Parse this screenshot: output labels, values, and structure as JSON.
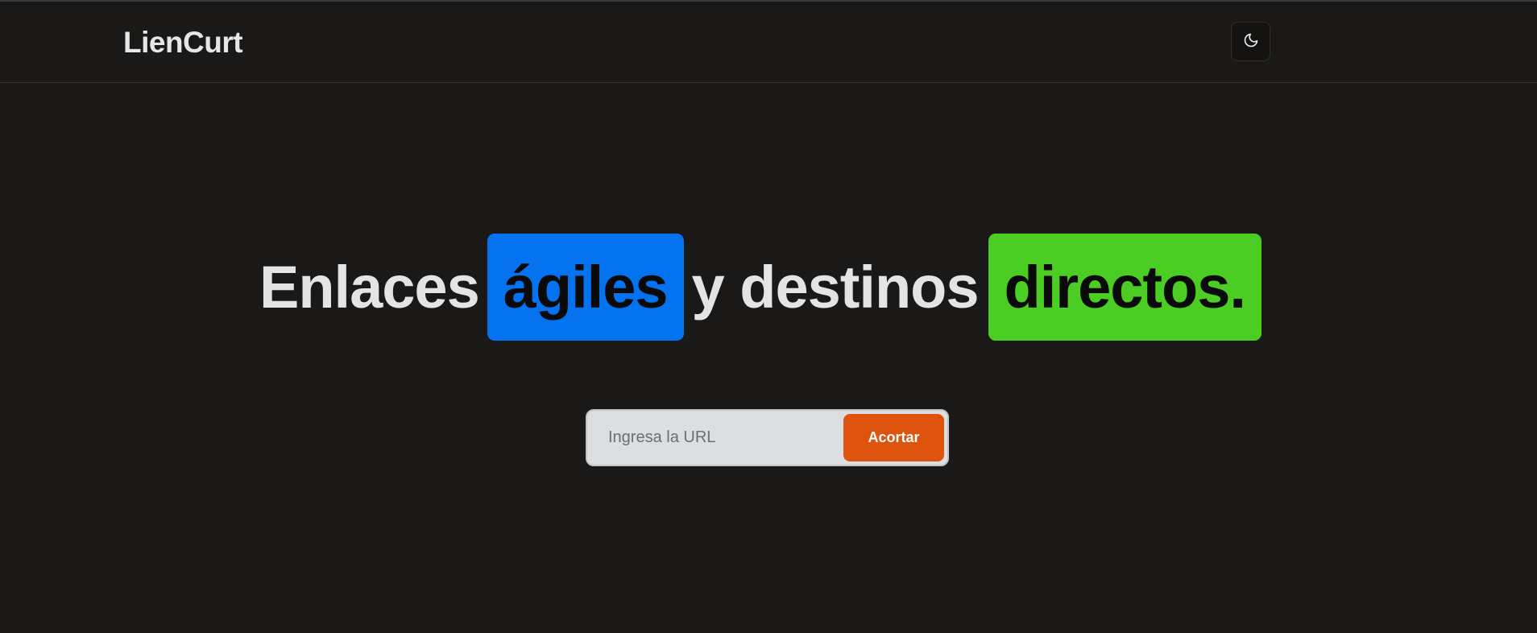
{
  "navbar": {
    "brand": "LienCurt",
    "theme_toggle_icon": "moon-icon"
  },
  "hero": {
    "word_1": "Enlaces",
    "highlight_1": "ágiles",
    "word_2": "y destinos",
    "highlight_2": "directos.",
    "colors": {
      "highlight_1_bg": "#0573f0",
      "highlight_2_bg": "#4ccd24",
      "page_bg": "#1a1918"
    }
  },
  "shortener": {
    "input_placeholder": "Ingresa la URL",
    "input_value": "",
    "submit_label": "Acortar",
    "submit_color": "#de540f"
  }
}
